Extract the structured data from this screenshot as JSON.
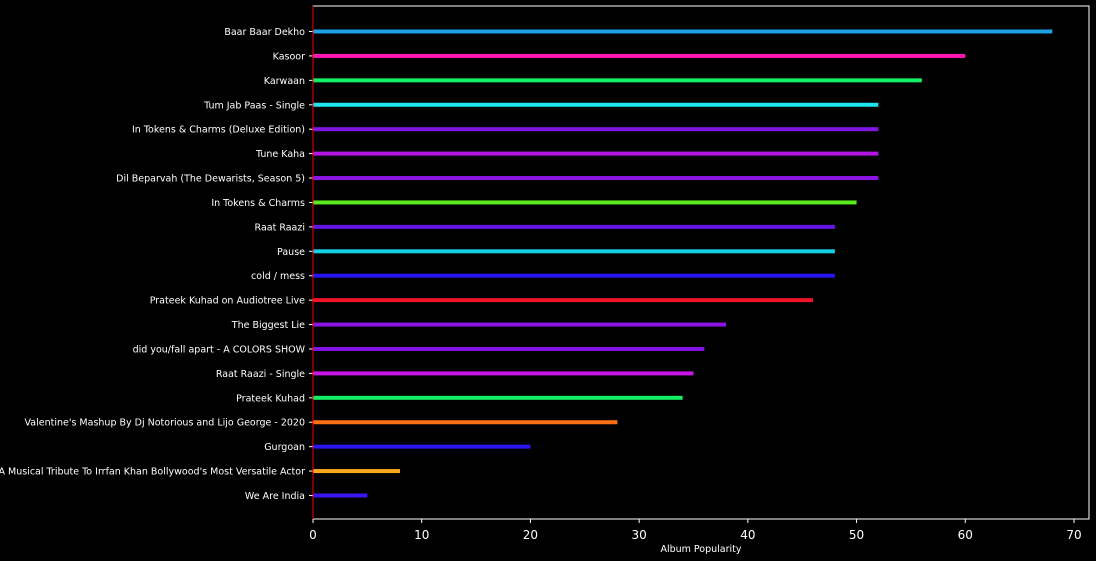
{
  "chart_data": {
    "type": "bar",
    "orientation": "horizontal",
    "title": "",
    "xlabel": "Album Popularity",
    "ylabel": "",
    "xlim": [
      0,
      71
    ],
    "xticks": [
      0,
      10,
      20,
      30,
      40,
      50,
      60,
      70
    ],
    "xtick_labels": [
      "0",
      "10",
      "20",
      "30",
      "40",
      "50",
      "60",
      "70"
    ],
    "grid": false,
    "categories": [
      "Baar Baar Dekho",
      "Kasoor",
      "Karwaan",
      "Tum Jab Paas - Single",
      "In Tokens & Charms (Deluxe Edition)",
      "Tune Kaha",
      "Dil Beparvah (The Dewarists, Season 5)",
      "In Tokens & Charms",
      "Raat Raazi",
      "Pause",
      "cold / mess",
      "Prateek Kuhad on Audiotree Live",
      "The Biggest Lie",
      "did you/fall apart - A COLORS SHOW",
      "Raat Raazi - Single",
      "Prateek Kuhad",
      "Valentine's Mashup By Dj Notorious and Lijo George - 2020",
      "Gurgoan",
      "A Musical Tribute To Irrfan Khan Bollywood's Most Versatile Actor",
      "We Are India"
    ],
    "values": [
      68,
      60,
      56,
      52,
      52,
      52,
      52,
      50,
      48,
      48,
      48,
      46,
      38,
      36,
      35,
      34,
      28,
      20,
      8,
      5
    ],
    "colors": [
      "#1ca0e6",
      "#ff14b4",
      "#14f064",
      "#1ee6f0",
      "#8214e6",
      "#b414e6",
      "#8c14e6",
      "#5aeb1e",
      "#6414e6",
      "#14d2e6",
      "#2814f0",
      "#f01428",
      "#8c14e6",
      "#8214e6",
      "#c814e6",
      "#14f064",
      "#ff6e14",
      "#2814f0",
      "#ffaa1e",
      "#3c14f0"
    ],
    "background": "#000000",
    "axis_color": "#ffffff",
    "left_spine_color": "#ff0000"
  }
}
